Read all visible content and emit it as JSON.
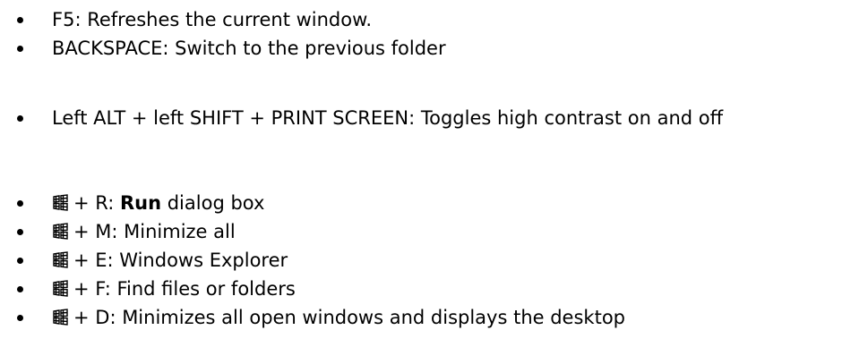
{
  "groups": [
    {
      "items": [
        {
          "text": "F5: Refreshes the current window."
        },
        {
          "text": "BACKSPACE: Switch to the previous folder"
        }
      ]
    },
    {
      "items": [
        {
          "text": "Left ALT + left SHIFT + PRINT SCREEN: Toggles high contrast on and off"
        }
      ]
    },
    {
      "icon": "windows-logo-icon",
      "items": [
        {
          "pre": "+ R: ",
          "bold": "Run",
          "post": " dialog box"
        },
        {
          "pre": "+ M: Minimize all"
        },
        {
          "pre": "+ E: Windows Explorer"
        },
        {
          "pre": "+ F: Find files or folders"
        },
        {
          "pre": "+ D: Minimizes all open windows and displays the desktop"
        }
      ]
    }
  ]
}
